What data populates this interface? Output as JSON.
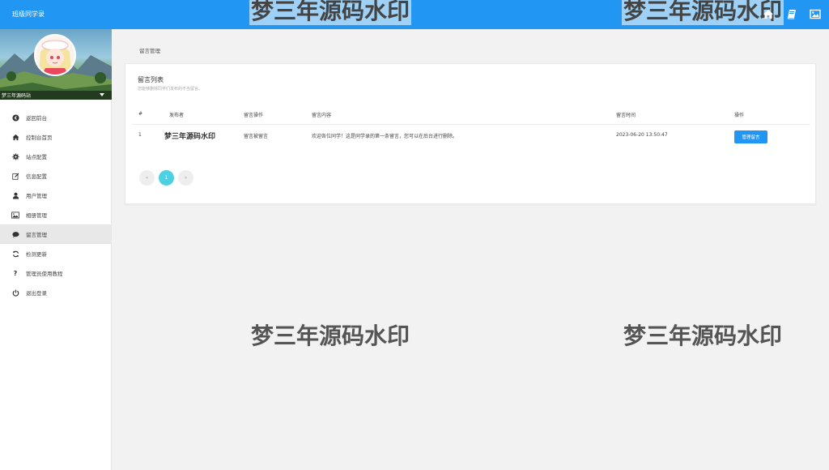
{
  "app": {
    "title": "班级同学录"
  },
  "topbar": {
    "icons": [
      "home-icon",
      "book-icon",
      "image-icon"
    ]
  },
  "sidebar": {
    "username": "梦三年源码站",
    "items": [
      {
        "label": "返回前台",
        "icon": "back-circle-icon"
      },
      {
        "label": "控制台首页",
        "icon": "home-icon"
      },
      {
        "label": "站点配置",
        "icon": "gear-icon"
      },
      {
        "label": "信息配置",
        "icon": "edit-icon"
      },
      {
        "label": "用户管理",
        "icon": "user-icon"
      },
      {
        "label": "相册管理",
        "icon": "image-icon"
      },
      {
        "label": "留言管理",
        "icon": "comment-icon"
      },
      {
        "label": "检测更新",
        "icon": "refresh-icon"
      },
      {
        "label": "管理员使用教程",
        "icon": "question-icon"
      },
      {
        "label": "退出登录",
        "icon": "power-icon"
      }
    ],
    "active_index": 6
  },
  "breadcrumb": "留言管理",
  "card": {
    "title": "留言列表",
    "subtitle": "您能够删除同学们发布的不当留言。",
    "columns": [
      "#",
      "发布者",
      "留言操作",
      "留言内容",
      "留言时间",
      "操作"
    ],
    "rows": [
      {
        "index": "1",
        "publisher": "梦三年源码水印",
        "operation": "留言被留言",
        "content": "欢迎各位同学！这是同学录的第一条留言，您可以在后台进行删除。",
        "time": "2023-06-20 13:50:47",
        "action_label": "管理留言"
      }
    ]
  },
  "pagination": {
    "prev": "«",
    "current": "1",
    "next": "»"
  },
  "watermark": "梦三年源码水印",
  "colors": {
    "primary": "#2196f3",
    "page_active": "#4dd0e1"
  }
}
